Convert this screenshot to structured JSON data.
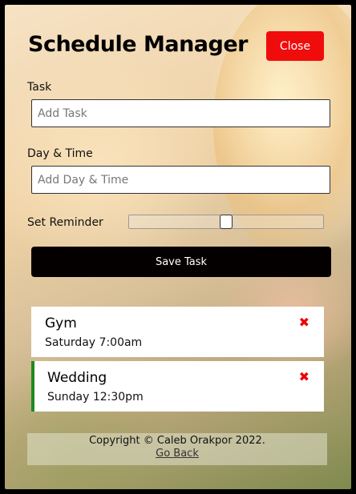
{
  "app": {
    "title": "Schedule Manager",
    "close_label": "Close"
  },
  "form": {
    "task_label": "Task",
    "task_placeholder": "Add Task",
    "task_value": "",
    "datetime_label": "Day & Time",
    "datetime_placeholder": "Add Day & Time",
    "datetime_value": "",
    "reminder_label": "Set Reminder",
    "reminder_value": 0.5,
    "save_label": "Save Task"
  },
  "tasks": [
    {
      "title": "Gym",
      "time": "Saturday 7:00am",
      "reminder": false
    },
    {
      "title": "Wedding",
      "time": "Sunday 12:30pm",
      "reminder": true
    }
  ],
  "footer": {
    "copyright": "Copyright © Caleb Orakpor 2022.",
    "link": "Go Back"
  },
  "colors": {
    "close_button": "#f10c0c",
    "save_button": "#050000",
    "reminder_border": "#1f8a1f",
    "delete_icon": "#e00000"
  },
  "icons": {
    "delete": "close-icon"
  }
}
